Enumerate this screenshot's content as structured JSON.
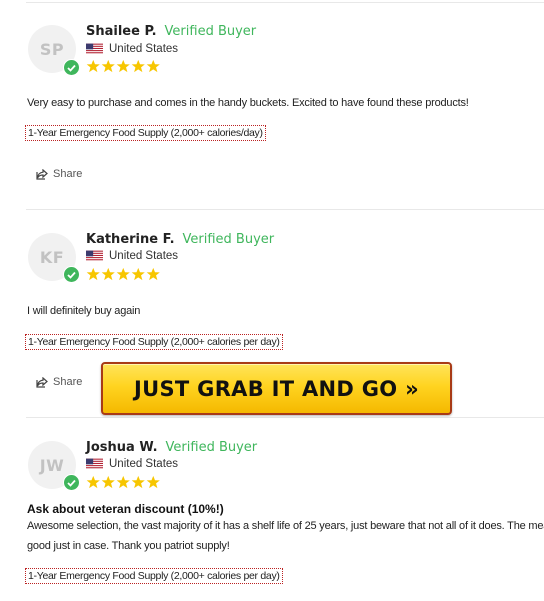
{
  "reviews": [
    {
      "initials": "SP",
      "name": "Shailee P.",
      "verified": "Verified Buyer",
      "country": "United States",
      "rating": 5,
      "title": "",
      "body": [
        "Very easy to purchase and comes in the handy buckets. Excited to have found these products!"
      ],
      "product": "1-Year Emergency Food Supply (2,000+ calories/day)",
      "share": "Share"
    },
    {
      "initials": "KF",
      "name": "Katherine F.",
      "verified": "Verified Buyer",
      "country": "United States",
      "rating": 5,
      "title": "",
      "body": [
        "I will definitely buy again"
      ],
      "product": "1-Year Emergency Food Supply (2,000+ calories per day)",
      "share": "Share"
    },
    {
      "initials": "JW",
      "name": "Joshua W.",
      "verified": "Verified Buyer",
      "country": "United States",
      "rating": 5,
      "title": "Ask about veteran discount (10%!)",
      "body": [
        "Awesome selection, the vast majority of it has a shelf life of 25 years, just beware that not all of it does. The meal",
        "good just in case. Thank you patriot supply!"
      ],
      "product": "1-Year Emergency Food Supply (2,000+ calories per day)",
      "share": ""
    }
  ],
  "cta": {
    "label": "JUST GRAB IT AND GO »"
  },
  "colors": {
    "verified": "#3fb65c",
    "star": "#f7c600",
    "cta_bg": "#ffd420",
    "cta_border": "#a83a16"
  },
  "icons": {
    "badge": "check-badge-icon",
    "share": "share-icon",
    "flag": "us-flag-icon",
    "star": "star-icon"
  }
}
